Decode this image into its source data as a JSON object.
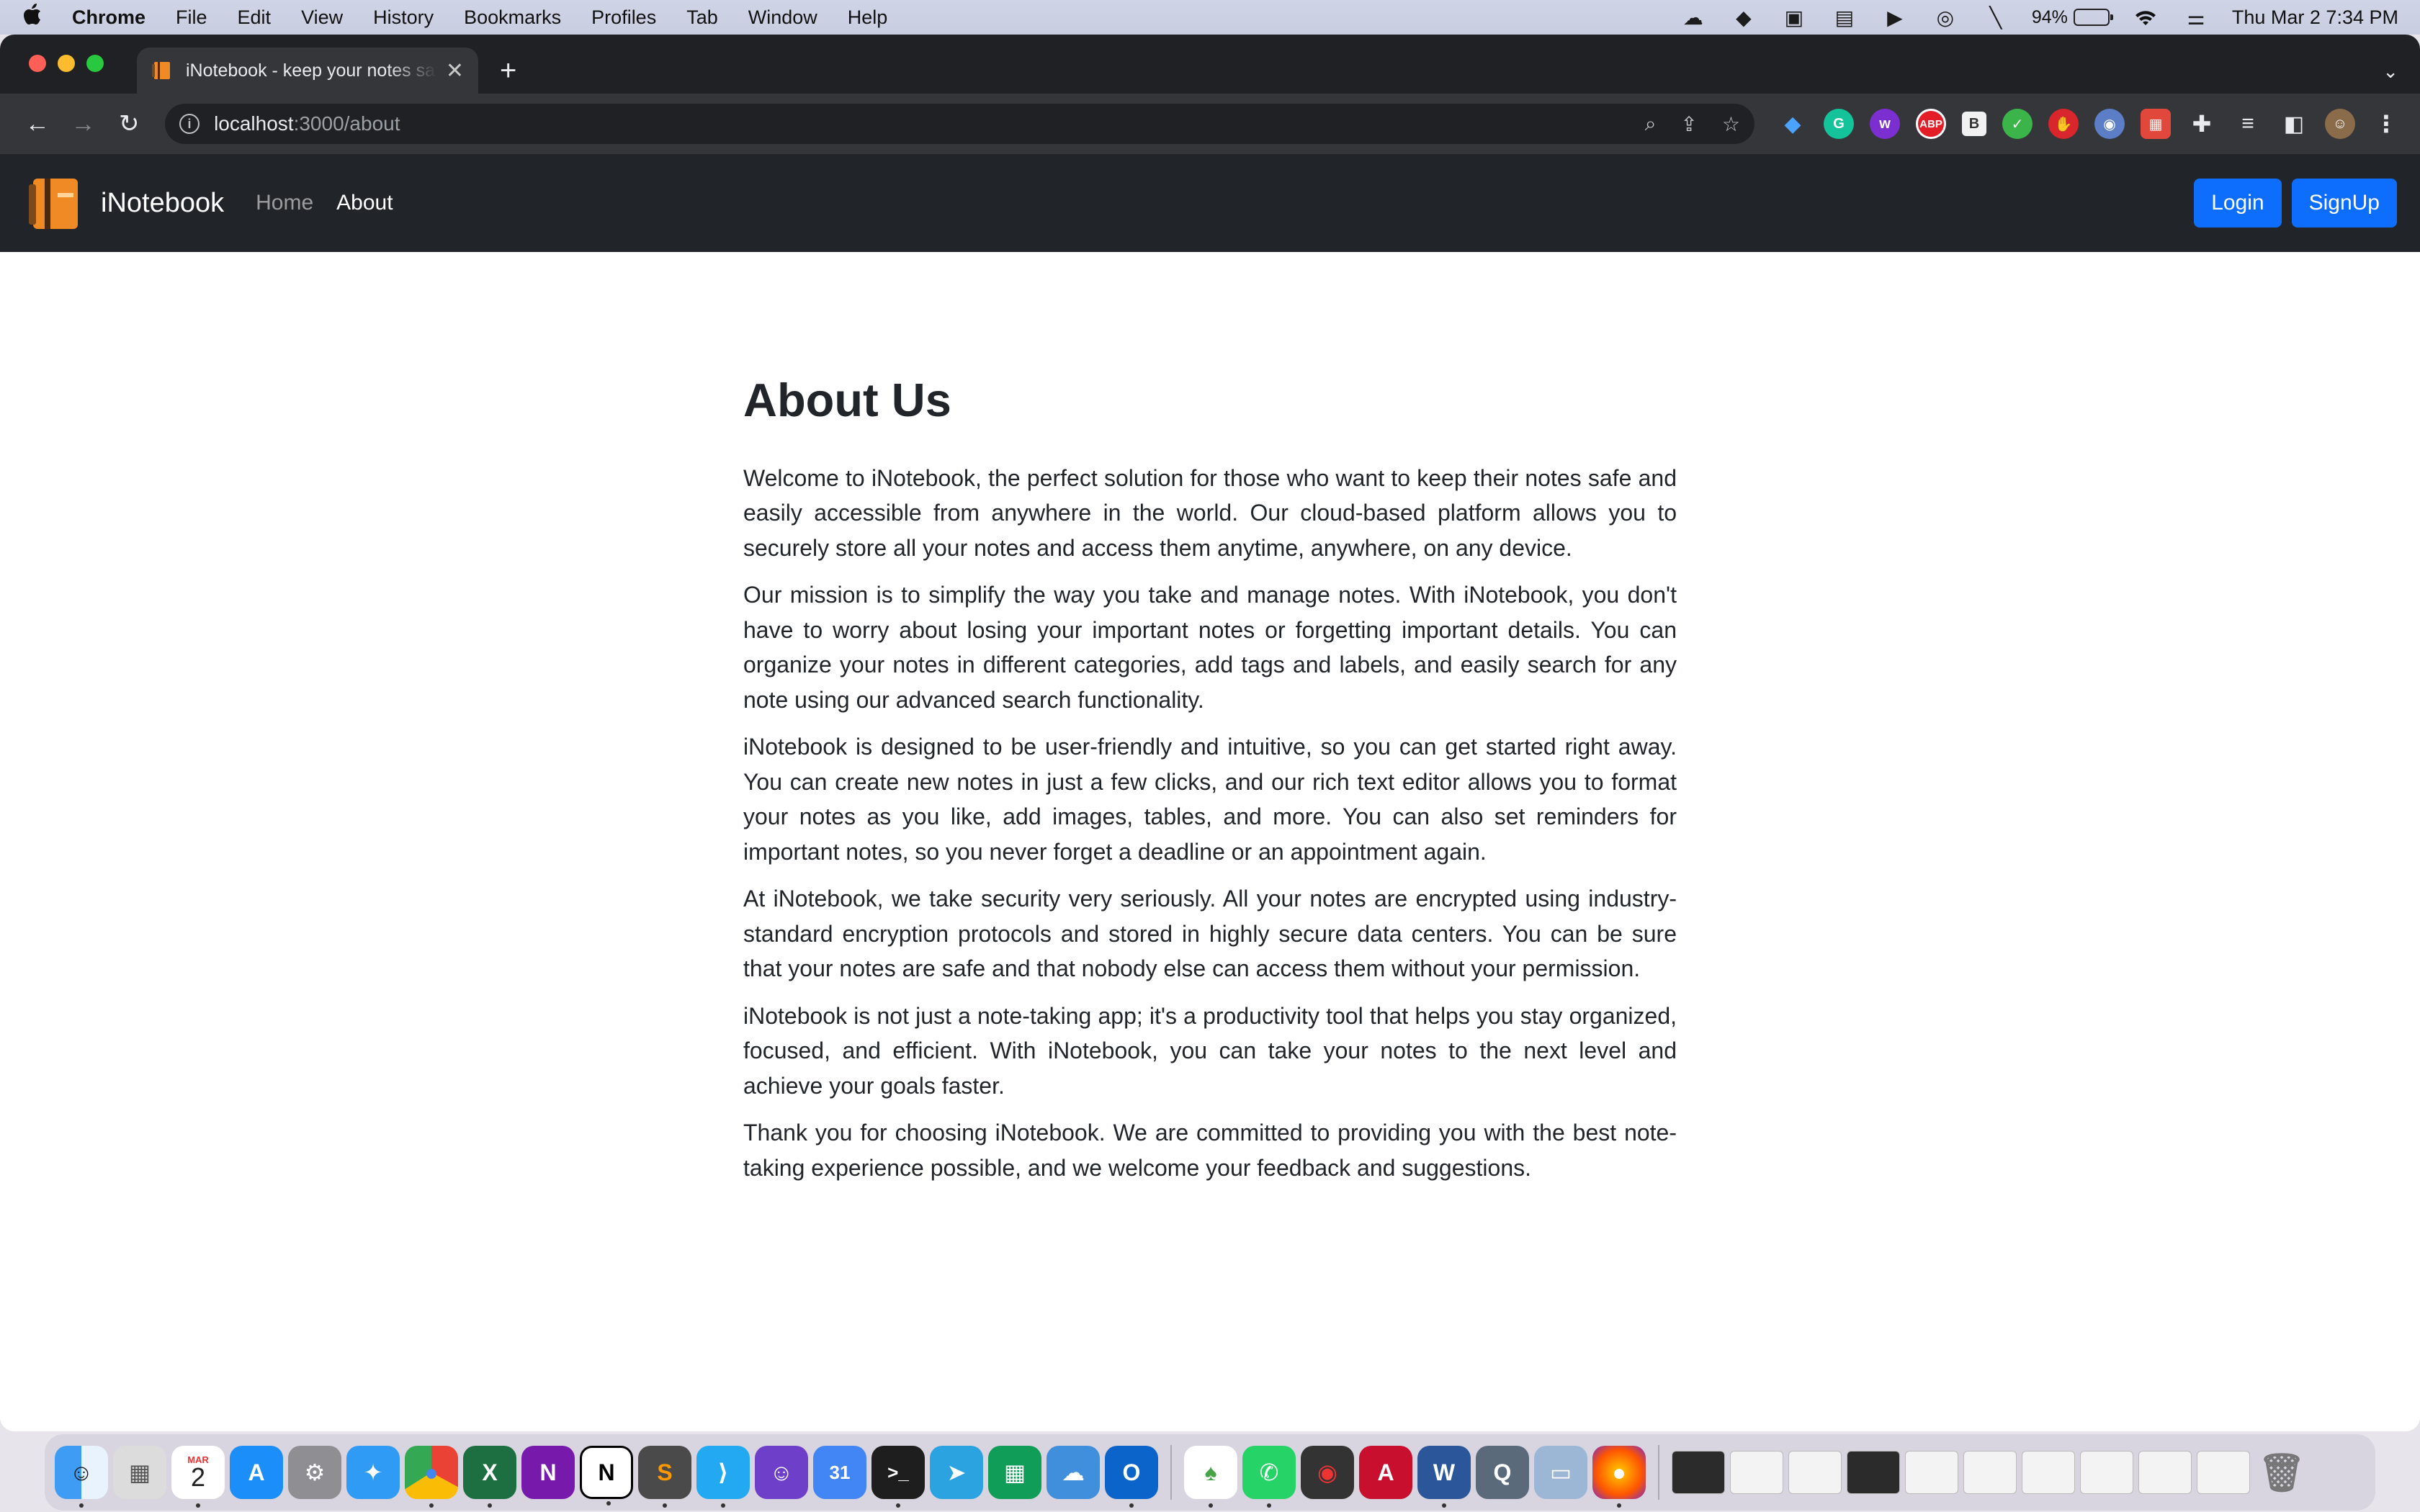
{
  "menubar": {
    "app_name": "Chrome",
    "items": [
      "File",
      "Edit",
      "View",
      "History",
      "Bookmarks",
      "Profiles",
      "Tab",
      "Window",
      "Help"
    ],
    "battery_percent": "94%",
    "clock": "Thu Mar 2  7:34 PM"
  },
  "browser": {
    "tab_title": "iNotebook - keep your notes safe",
    "url_host": "localhost",
    "url_path": ":3000/about",
    "extension_badge": "ABP",
    "extension_b": "B"
  },
  "navbar": {
    "brand": "iNotebook",
    "links": [
      "Home",
      "About"
    ],
    "active_link": "About",
    "login_label": "Login",
    "signup_label": "SignUp"
  },
  "about": {
    "heading": "About Us",
    "paragraphs": [
      "Welcome to iNotebook, the perfect solution for those who want to keep their notes safe and easily accessible from anywhere in the world. Our cloud-based platform allows you to securely store all your notes and access them anytime, anywhere, on any device.",
      "Our mission is to simplify the way you take and manage notes. With iNotebook, you don't have to worry about losing your important notes or forgetting important details. You can organize your notes in different categories, add tags and labels, and easily search for any note using our advanced search functionality.",
      "iNotebook is designed to be user-friendly and intuitive, so you can get started right away. You can create new notes in just a few clicks, and our rich text editor allows you to format your notes as you like, add images, tables, and more. You can also set reminders for important notes, so you never forget a deadline or an appointment again.",
      "At iNotebook, we take security very seriously. All your notes are encrypted using industry-standard encryption protocols and stored in highly secure data centers. You can be sure that your notes are safe and that nobody else can access them without your permission.",
      "iNotebook is not just a note-taking app; it's a productivity tool that helps you stay organized, focused, and efficient. With iNotebook, you can take your notes to the next level and achieve your goals faster.",
      "Thank you for choosing iNotebook. We are committed to providing you with the best note-taking experience possible, and we welcome your feedback and suggestions."
    ]
  },
  "dock": {
    "calendar_month": "MAR",
    "calendar_day": "2",
    "gcal_day": "31"
  },
  "colors": {
    "navbar_bg": "#212529",
    "primary_button": "#0d6efd",
    "chrome_dark": "#202124"
  }
}
